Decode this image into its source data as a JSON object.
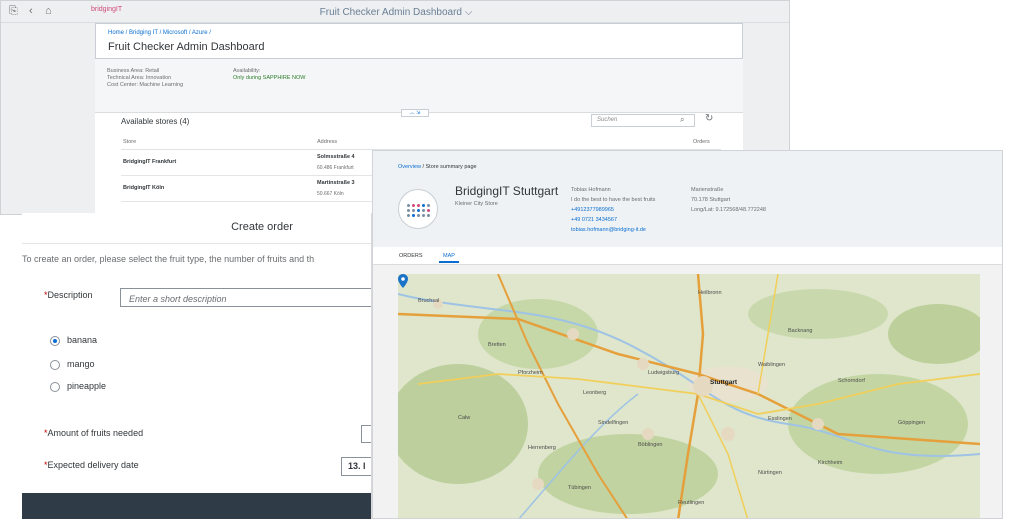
{
  "admin": {
    "app_title": "Fruit Checker Admin Dashboard ⌵",
    "logo": "bridgingIT",
    "breadcrumb": "Home / Bridging IT / Microsoft / Azure /",
    "title": "Fruit Checker Admin Dashboard",
    "business_area": "Business Area: Retail",
    "technical_area": "Technical Area: Innovation",
    "cost_center": "Cost Center: Machine Learning",
    "availability_label": "Availability:",
    "availability_value": "Only during SAPPHIRE NOW",
    "stores_title": "Available stores (4)",
    "search_placeholder": "Suchen",
    "columns": {
      "store": "Store",
      "address": "Address",
      "orders": "Orders"
    },
    "rows": [
      {
        "store": "BridgingIT Frankfurt",
        "street": "Solmsstraße 4",
        "city": "60.486 Frankfurt"
      },
      {
        "store": "BridgingIT Köln",
        "street": "Martinstraße 3",
        "city": "50.667 Köln"
      }
    ]
  },
  "order": {
    "title": "Create order",
    "intro": "To create an order, please select the fruit type, the number of fruits and th",
    "description_label": "Description",
    "description_placeholder": "Enter a short description",
    "fruits": [
      {
        "label": "banana",
        "selected": true
      },
      {
        "label": "mango",
        "selected": false
      },
      {
        "label": "pineapple",
        "selected": false
      }
    ],
    "amount_label": "Amount of fruits needed",
    "delivery_label": "Expected delivery date",
    "delivery_value": "13. l"
  },
  "store_page": {
    "breadcrumb_link": "Overview",
    "breadcrumb_rest": " / Store summary page",
    "name": "BridgingIT Stuttgart",
    "subtitle": "Kleiner City Store",
    "contact_name": "Tobias Hofmann",
    "contact_slogan": "I do the best to have the best fruits",
    "phone1": "+4912377989965",
    "phone2": "+49 0721 3434567",
    "email": "tobias.hofmann@bridging-it.de",
    "street": "Marienstraße",
    "city": "70.178 Stuttgart",
    "longlat": "Long/Lat: 9.172568/48.772248",
    "tabs": [
      "ORDERS",
      "MAP"
    ],
    "active_tab": "MAP",
    "map_labels": [
      "Bruchsal",
      "Bretten",
      "Pforzheim",
      "Ludwigsburg",
      "Stuttgart",
      "Esslingen",
      "Böblingen",
      "Sindelfingen",
      "Leonberg",
      "Waiblingen",
      "Schorndorf",
      "Göppingen",
      "Heilbronn",
      "Nürtingen",
      "Kirchheim",
      "Herrenberg",
      "Tübingen",
      "Reutlingen",
      "Calw",
      "Backnang"
    ]
  },
  "colors": {
    "accent": "#0a6ed1",
    "required": "#bb0000",
    "availability": "#2b7d2b",
    "footer": "#2f3c48"
  }
}
